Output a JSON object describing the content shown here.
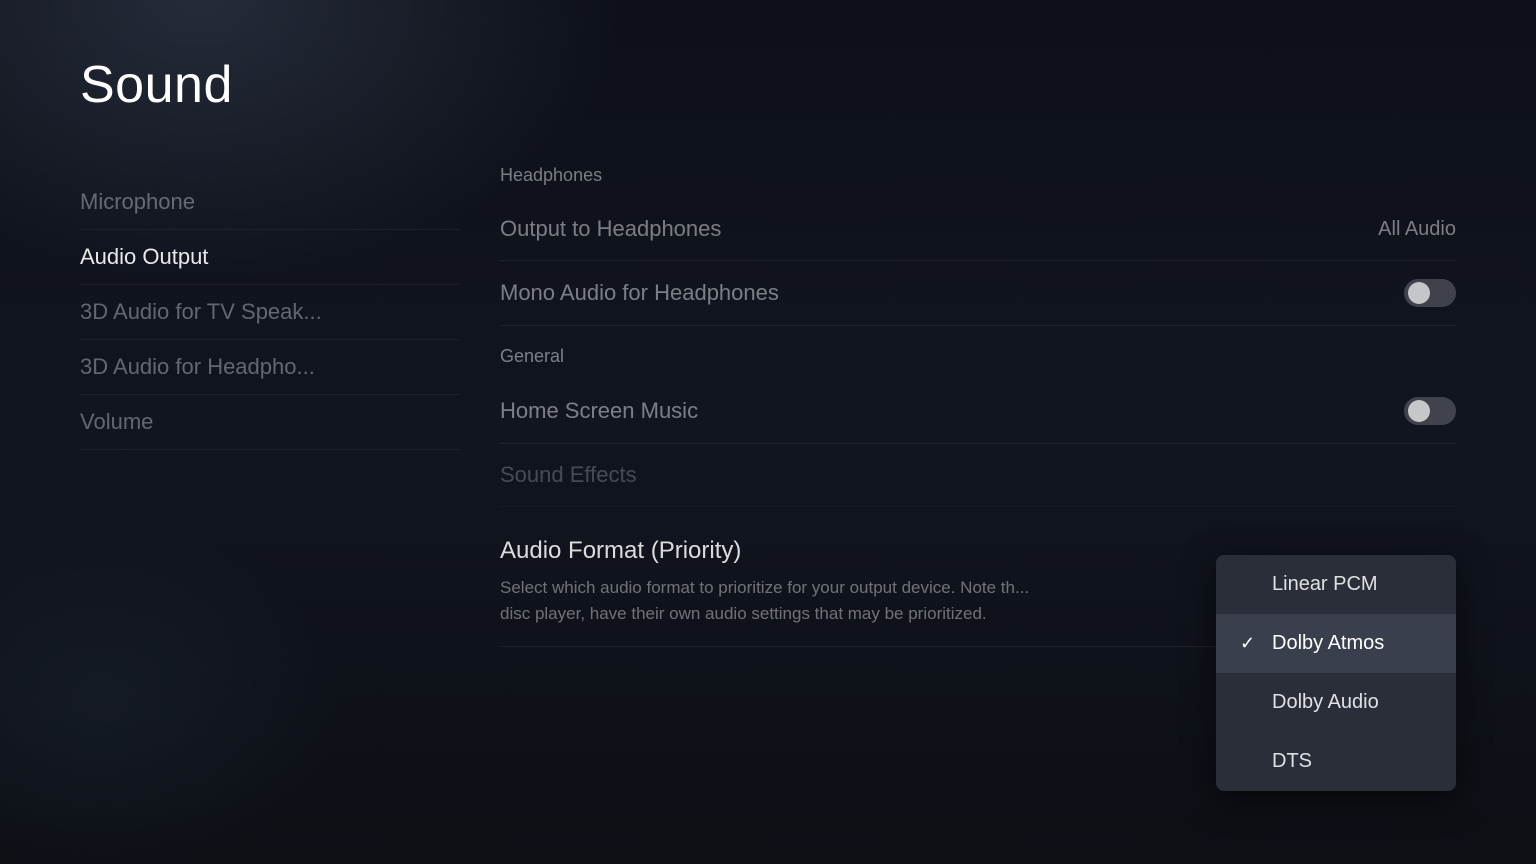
{
  "page": {
    "title": "Sound"
  },
  "sidebar": {
    "items": [
      {
        "id": "microphone",
        "label": "Microphone",
        "active": false
      },
      {
        "id": "audio-output",
        "label": "Audio Output",
        "active": true
      },
      {
        "id": "3d-audio-tv",
        "label": "3D Audio for TV Speak...",
        "active": false
      },
      {
        "id": "3d-audio-headphones",
        "label": "3D Audio for Headpho...",
        "active": false
      },
      {
        "id": "volume",
        "label": "Volume",
        "active": false
      }
    ]
  },
  "main": {
    "sections": {
      "headphones": {
        "label": "Headphones",
        "rows": [
          {
            "id": "output-to-headphones",
            "label": "Output to Headphones",
            "value": "All Audio"
          },
          {
            "id": "mono-audio",
            "label": "Mono Audio for Headphones",
            "toggle": true,
            "enabled": false
          }
        ]
      },
      "general": {
        "label": "General",
        "rows": [
          {
            "id": "home-screen-music",
            "label": "Home Screen Music",
            "toggle": true,
            "enabled": false
          },
          {
            "id": "sound-effects",
            "label": "Sound Effects",
            "toggle": false
          }
        ]
      },
      "audio_format": {
        "title": "Audio Format (Priority)",
        "description": "Select which audio format to prioritize for your output device. Note th... disc player, have their own audio settings that may be prioritized."
      }
    },
    "dropdown": {
      "items": [
        {
          "id": "linear-pcm",
          "label": "Linear PCM",
          "selected": false
        },
        {
          "id": "dolby-atmos",
          "label": "Dolby Atmos",
          "selected": true
        },
        {
          "id": "dolby-audio",
          "label": "Dolby Audio",
          "selected": false
        },
        {
          "id": "dts",
          "label": "DTS",
          "selected": false
        }
      ]
    }
  }
}
